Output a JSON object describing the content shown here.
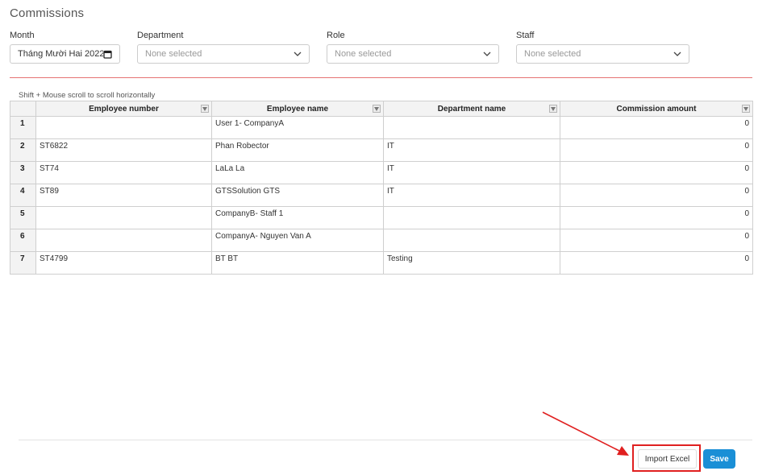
{
  "page": {
    "title": "Commissions"
  },
  "filters": {
    "month": {
      "label": "Month",
      "value": "Tháng Mười Hai  2022"
    },
    "department": {
      "label": "Department",
      "placeholder": "None selected"
    },
    "role": {
      "label": "Role",
      "placeholder": "None selected"
    },
    "staff": {
      "label": "Staff",
      "placeholder": "None selected"
    }
  },
  "table": {
    "hint": "Shift + Mouse scroll to scroll horizontally",
    "columns": [
      "Employee number",
      "Employee name",
      "Department name",
      "Commission amount"
    ],
    "rows": [
      {
        "index": "1",
        "employee_number": "",
        "employee_name": "User 1- CompanyA",
        "department": "",
        "commission": "0"
      },
      {
        "index": "2",
        "employee_number": "ST6822",
        "employee_name": "Phan Robector",
        "department": "IT",
        "commission": "0"
      },
      {
        "index": "3",
        "employee_number": "ST74",
        "employee_name": "LaLa La",
        "department": "IT",
        "commission": "0"
      },
      {
        "index": "4",
        "employee_number": "ST89",
        "employee_name": "GTSSolution GTS",
        "department": "IT",
        "commission": "0"
      },
      {
        "index": "5",
        "employee_number": "",
        "employee_name": "CompanyB- Staff 1",
        "department": "",
        "commission": "0"
      },
      {
        "index": "6",
        "employee_number": "",
        "employee_name": "CompanyA- Nguyen Van A",
        "department": "",
        "commission": "0"
      },
      {
        "index": "7",
        "employee_number": "ST4799",
        "employee_name": "BT BT",
        "department": "Testing",
        "commission": "0"
      }
    ]
  },
  "actions": {
    "import_label": "Import Excel",
    "save_label": "Save"
  },
  "colors": {
    "accent": "#1a8fd6",
    "highlight": "#e02020",
    "divider": "#e57373"
  },
  "icons": [
    "calendar-icon",
    "chevron-down-icon",
    "column-filter-icon",
    "arrow-annotation"
  ]
}
